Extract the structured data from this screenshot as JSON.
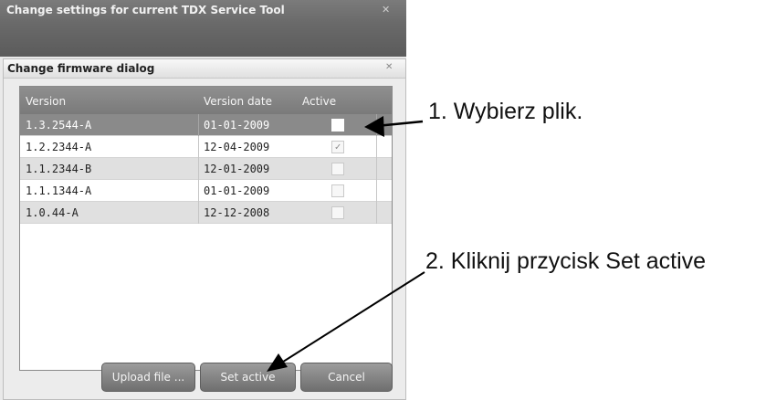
{
  "outer_window": {
    "title": "Change settings for current TDX Service Tool",
    "close_glyph": "✕"
  },
  "dialog": {
    "title": "Change firmware dialog",
    "close_glyph": "✕"
  },
  "table": {
    "headers": {
      "version": "Version",
      "date": "Version date",
      "active": "Active"
    },
    "rows": [
      {
        "version": "1.3.2544-A",
        "date": "01-01-2009",
        "active": false,
        "selected": true
      },
      {
        "version": "1.2.2344-A",
        "date": "12-04-2009",
        "active": true,
        "selected": false
      },
      {
        "version": "1.1.2344-B",
        "date": "12-01-2009",
        "active": false,
        "selected": false
      },
      {
        "version": "1.1.1344-A",
        "date": "01-01-2009",
        "active": false,
        "selected": false
      },
      {
        "version": "1.0.44-A",
        "date": "12-12-2008",
        "active": false,
        "selected": false
      }
    ]
  },
  "buttons": {
    "upload": "Upload file ...",
    "set_active": "Set active",
    "cancel": "Cancel"
  },
  "annotations": {
    "step1": "1.  Wybierz plik.",
    "step2": "2. Kliknij przycisk Set active"
  },
  "colors": {
    "header_bg": "#7f7f7f",
    "selected_row": "#8a8a8a",
    "alt_row": "#e0e0e0"
  }
}
